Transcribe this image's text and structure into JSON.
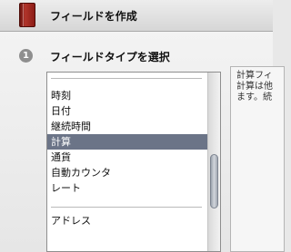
{
  "header": {
    "title": "フィールドを作成"
  },
  "step": {
    "number": "1",
    "title": "フィールドタイプを選択"
  },
  "field_types": {
    "items": [
      "時刻",
      "日付",
      "継続時間",
      "計算",
      "通貨",
      "自動カウンタ",
      "レート",
      "アドレス"
    ],
    "selected": "計算"
  },
  "description": {
    "lines": [
      "計算フィ",
      "計算は他",
      "ます。続"
    ]
  }
}
